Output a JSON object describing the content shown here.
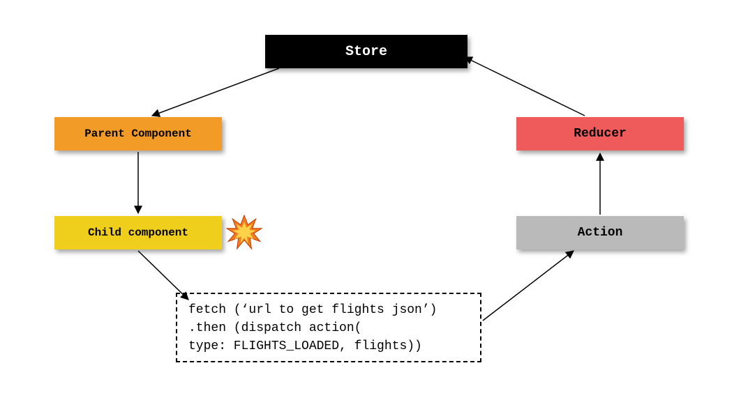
{
  "nodes": {
    "store": "Store",
    "parent": "Parent Component",
    "child": "Child component",
    "reducer": "Reducer",
    "action": "Action"
  },
  "code": {
    "line1": "fetch (‘url to get flights json’)",
    "line2": ".then (dispatch action(",
    "line3": "type: FLIGHTS_LOADED, flights))"
  },
  "icons": {
    "collision": "collision-icon"
  },
  "colors": {
    "store_bg": "#000000",
    "store_fg": "#ffffff",
    "parent_bg": "#f29b27",
    "child_bg": "#efcf1b",
    "reducer_bg": "#ef5a5a",
    "action_bg": "#bababa",
    "arrow": "#000000"
  },
  "arrows": [
    {
      "from": "store",
      "to": "parent"
    },
    {
      "from": "parent",
      "to": "child"
    },
    {
      "from": "child",
      "to": "code"
    },
    {
      "from": "code",
      "to": "action"
    },
    {
      "from": "action",
      "to": "reducer"
    },
    {
      "from": "reducer",
      "to": "store"
    }
  ]
}
